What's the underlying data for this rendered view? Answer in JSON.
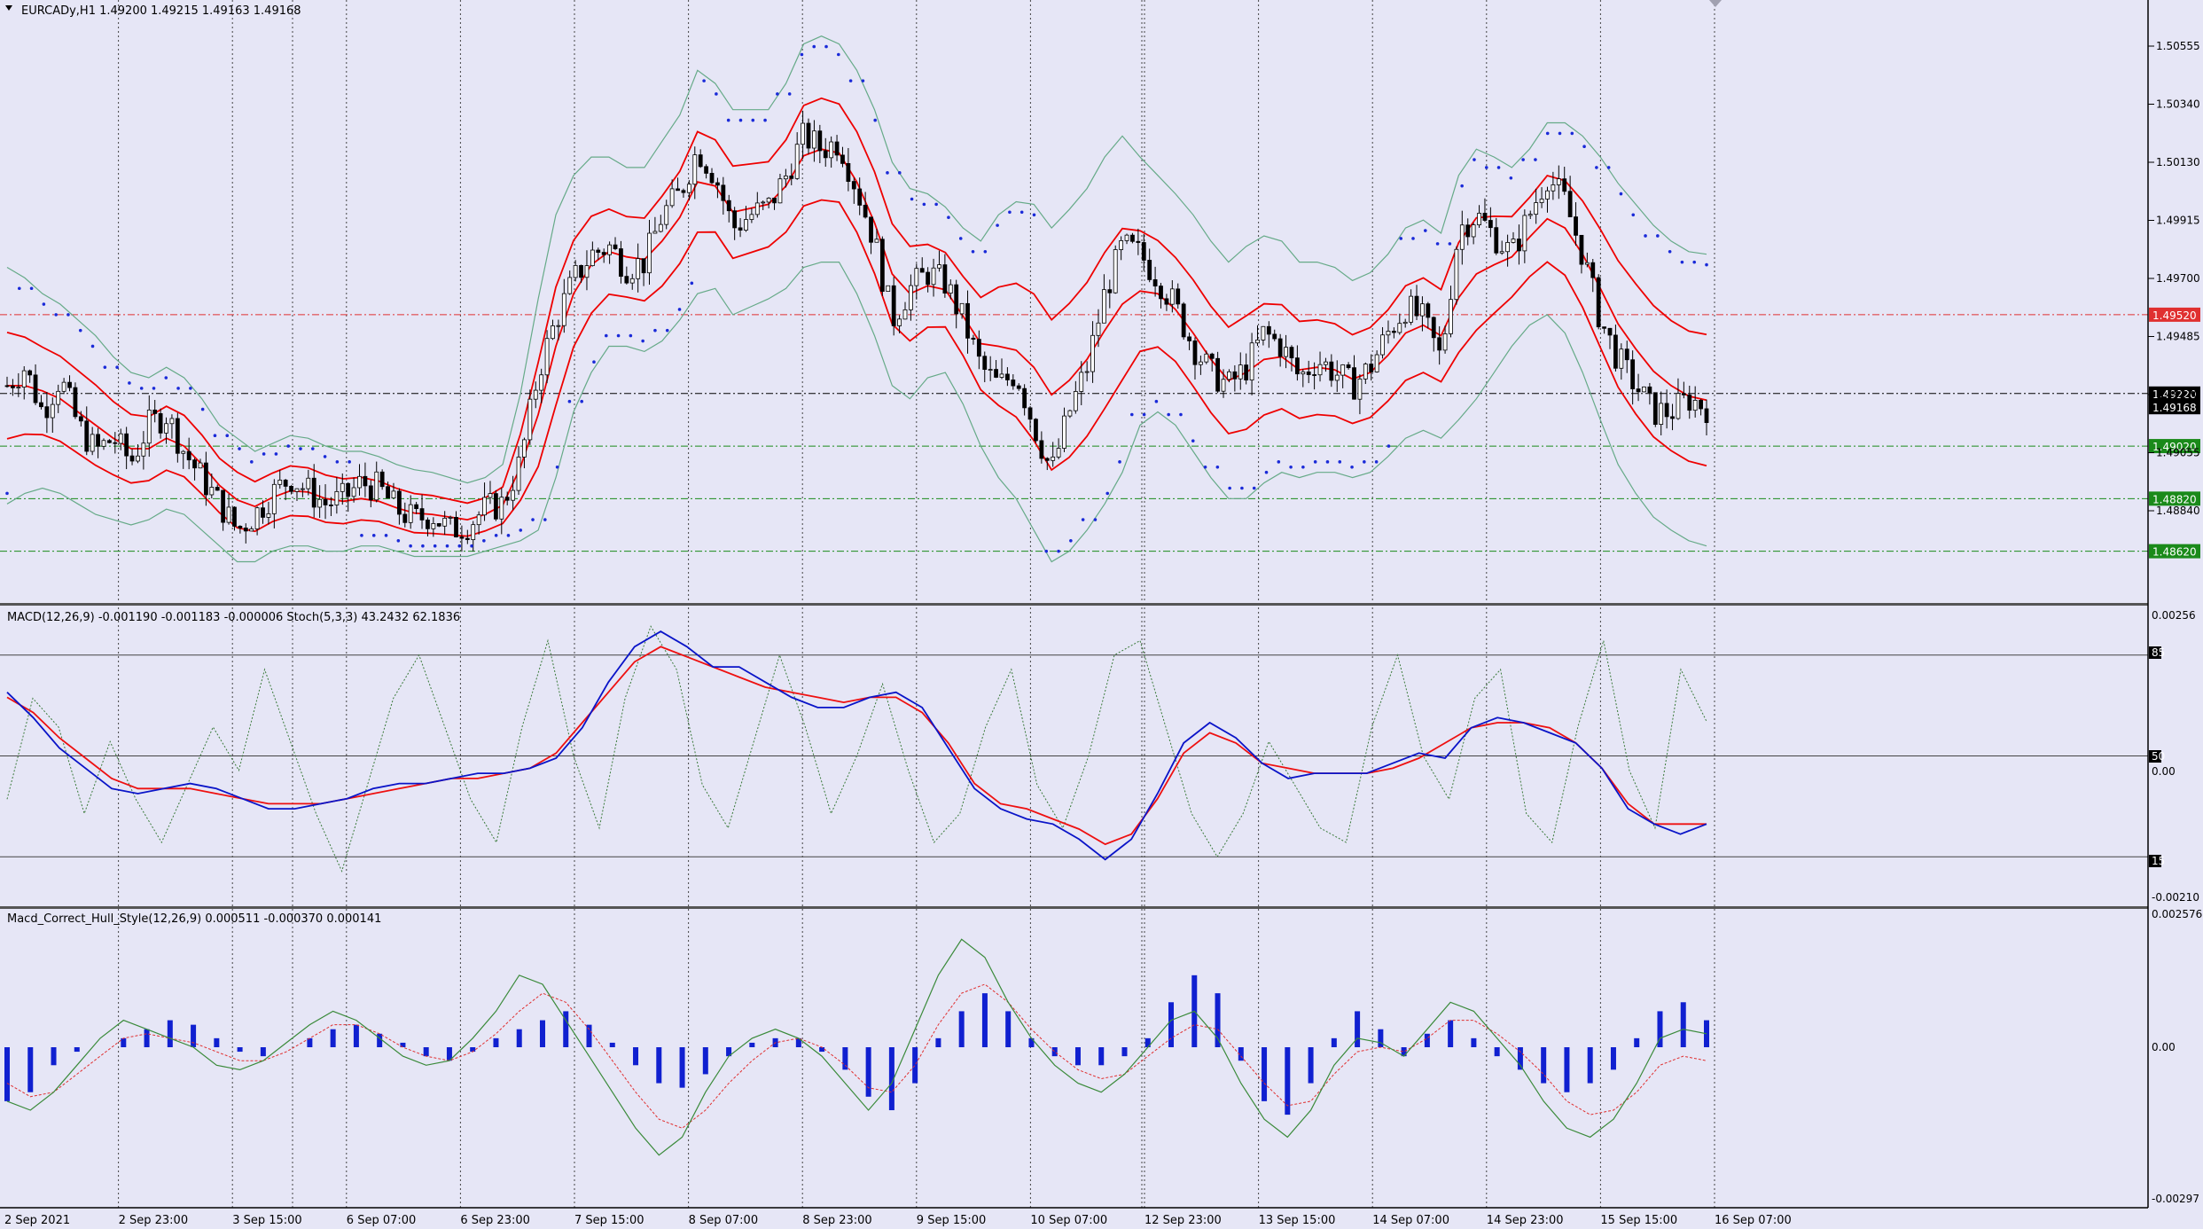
{
  "chart_data": {
    "type": "line",
    "main": {
      "title": "EURCADy,H1  1.49200 1.49215 1.49163 1.49168",
      "ylim": [
        1.4845,
        1.5065
      ],
      "price_ticks": [
        "1.50555",
        "1.50340",
        "1.50130",
        "1.49915",
        "1.49700",
        "1.49485",
        "1.49270",
        "1.49055",
        "1.48840"
      ],
      "levels": [
        {
          "label": "1.49520",
          "value": 1.4952,
          "color": "#e03030"
        },
        {
          "label": "1.49220",
          "value": 1.4922,
          "color": "#000000"
        },
        {
          "label": "1.49168",
          "value": 1.49168,
          "color": "#000000"
        },
        {
          "label": "1.49020",
          "value": 1.4902,
          "color": "#1a8a1a"
        },
        {
          "label": "1.48820",
          "value": 1.4882,
          "color": "#1a8a1a"
        },
        {
          "label": "1.48620",
          "value": 1.4862,
          "color": "#1a8a1a"
        }
      ],
      "close_series": [
        1.4925,
        1.4932,
        1.4915,
        1.4928,
        1.491,
        1.49,
        1.4905,
        1.4896,
        1.491,
        1.4914,
        1.49,
        1.489,
        1.488,
        1.487,
        1.4876,
        1.4884,
        1.489,
        1.4885,
        1.488,
        1.4882,
        1.4888,
        1.4886,
        1.4878,
        1.4874,
        1.4876,
        1.487,
        1.4872,
        1.4878,
        1.488,
        1.4896,
        1.493,
        1.495,
        1.4965,
        1.4975,
        1.4978,
        1.497,
        1.4972,
        1.499,
        1.4998,
        1.5015,
        1.5005,
        1.4985,
        1.499,
        1.4993,
        1.5005,
        1.502,
        1.5015,
        1.5018,
        1.5,
        1.498,
        1.495,
        1.4962,
        1.4968,
        1.4964,
        1.495,
        1.4932,
        1.4925,
        1.493,
        1.491,
        1.4892,
        1.4915,
        1.4932,
        1.496,
        1.4978,
        1.4975,
        1.4966,
        1.4955,
        1.494,
        1.493,
        1.4925,
        1.4932,
        1.4945,
        1.494,
        1.4928,
        1.4935,
        1.493,
        1.4925,
        1.4932,
        1.4945,
        1.4955,
        1.495,
        1.4935,
        1.4985,
        1.499,
        1.4982,
        1.4975,
        1.499,
        1.5005,
        1.4995,
        1.4975,
        1.495,
        1.4935,
        1.4925,
        1.4915,
        1.4915,
        1.492,
        1.49168
      ],
      "upper_band": [
        1.497,
        1.4966,
        1.496,
        1.4956,
        1.495,
        1.4944,
        1.4936,
        1.493,
        1.4928,
        1.4932,
        1.4928,
        1.492,
        1.491,
        1.4905,
        1.49,
        1.4903,
        1.4906,
        1.4905,
        1.4902,
        1.49,
        1.49,
        1.4898,
        1.4895,
        1.4893,
        1.4892,
        1.489,
        1.4888,
        1.489,
        1.4895,
        1.4922,
        1.4958,
        1.499,
        1.5005,
        1.5012,
        1.5012,
        1.5008,
        1.5008,
        1.5018,
        1.5028,
        1.5045,
        1.504,
        1.503,
        1.503,
        1.503,
        1.504,
        1.5055,
        1.5058,
        1.5055,
        1.5045,
        1.503,
        1.501,
        1.5,
        1.4998,
        1.4993,
        1.4985,
        1.498,
        1.499,
        1.4995,
        1.4994,
        1.4985,
        1.4992,
        1.5,
        1.5012,
        1.502,
        1.5012,
        1.5005,
        1.4998,
        1.499,
        1.498,
        1.4972,
        1.4978,
        1.4982,
        1.498,
        1.4972,
        1.4972,
        1.497,
        1.4965,
        1.4968,
        1.4975,
        1.4985,
        1.4988,
        1.4983,
        1.5005,
        1.5015,
        1.5012,
        1.5008,
        1.5015,
        1.5025,
        1.5025,
        1.502,
        1.5012,
        1.5002,
        1.4994,
        1.4986,
        1.498,
        1.4976,
        1.4975
      ],
      "lower_band": [
        1.488,
        1.4884,
        1.4886,
        1.4884,
        1.488,
        1.4876,
        1.4874,
        1.4872,
        1.4874,
        1.4878,
        1.4876,
        1.487,
        1.4864,
        1.4858,
        1.4858,
        1.4862,
        1.4864,
        1.4864,
        1.4862,
        1.4862,
        1.4864,
        1.4864,
        1.4862,
        1.486,
        1.486,
        1.486,
        1.486,
        1.4862,
        1.4864,
        1.4866,
        1.487,
        1.489,
        1.4915,
        1.493,
        1.494,
        1.494,
        1.4938,
        1.4942,
        1.495,
        1.496,
        1.4962,
        1.4952,
        1.4955,
        1.4958,
        1.4962,
        1.497,
        1.4972,
        1.4972,
        1.496,
        1.4944,
        1.4925,
        1.492,
        1.4928,
        1.493,
        1.4918,
        1.4902,
        1.489,
        1.4882,
        1.487,
        1.4858,
        1.4862,
        1.487,
        1.488,
        1.4892,
        1.491,
        1.4915,
        1.491,
        1.49,
        1.489,
        1.4882,
        1.4882,
        1.4888,
        1.4892,
        1.489,
        1.4892,
        1.4892,
        1.489,
        1.4892,
        1.4898,
        1.4905,
        1.4908,
        1.4905,
        1.4912,
        1.492,
        1.493,
        1.494,
        1.4948,
        1.4952,
        1.4945,
        1.493,
        1.4912,
        1.4895,
        1.4884,
        1.4875,
        1.487,
        1.4866,
        1.4864
      ]
    },
    "macd_stoch": {
      "title": "MACD(12,26,9) -0.001190 -0.001183 -0.000006  Stoch(5,3,3) 43.2432 62.1836",
      "ticks": [
        "0.00256",
        "85",
        "50",
        "0.00",
        "15",
        "-0.00210"
      ],
      "macd": [
        0.0013,
        0.0008,
        0.0002,
        -0.0002,
        -0.0006,
        -0.0007,
        -0.0006,
        -0.0005,
        -0.0006,
        -0.0008,
        -0.001,
        -0.001,
        -0.0009,
        -0.0008,
        -0.0006,
        -0.0005,
        -0.0005,
        -0.0004,
        -0.0003,
        -0.0003,
        -0.0002,
        0.0,
        0.0006,
        0.0015,
        0.0022,
        0.0025,
        0.0022,
        0.0018,
        0.0018,
        0.0015,
        0.0012,
        0.001,
        0.001,
        0.0012,
        0.0013,
        0.001,
        0.0002,
        -0.0006,
        -0.001,
        -0.0012,
        -0.0013,
        -0.0016,
        -0.002,
        -0.0016,
        -0.0007,
        0.0003,
        0.0007,
        0.0004,
        -0.0001,
        -0.0004,
        -0.0003,
        -0.0003,
        -0.0003,
        -0.0001,
        0.0001,
        0.0,
        0.0006,
        0.0008,
        0.0007,
        0.0005,
        0.0003,
        -0.0002,
        -0.001,
        -0.0013,
        -0.0015,
        -0.0013
      ],
      "signal": [
        0.0012,
        0.0009,
        0.0004,
        0.0,
        -0.0004,
        -0.0006,
        -0.0006,
        -0.0006,
        -0.0007,
        -0.0008,
        -0.0009,
        -0.0009,
        -0.0009,
        -0.0008,
        -0.0007,
        -0.0006,
        -0.0005,
        -0.0004,
        -0.0004,
        -0.0003,
        -0.0002,
        0.0001,
        0.0007,
        0.0013,
        0.0019,
        0.0022,
        0.002,
        0.0018,
        0.0016,
        0.0014,
        0.0013,
        0.0012,
        0.0011,
        0.0012,
        0.0012,
        0.0009,
        0.0003,
        -0.0005,
        -0.0009,
        -0.001,
        -0.0012,
        -0.0014,
        -0.0017,
        -0.0015,
        -0.0008,
        0.0001,
        0.0005,
        0.0003,
        -0.0001,
        -0.0002,
        -0.0003,
        -0.0003,
        -0.0003,
        -0.0002,
        0.0,
        0.0003,
        0.0006,
        0.0007,
        0.0007,
        0.0006,
        0.0003,
        -0.0002,
        -0.0009,
        -0.0013,
        -0.0013,
        -0.0013
      ],
      "stoch": [
        35,
        70,
        60,
        30,
        55,
        35,
        20,
        40,
        60,
        45,
        80,
        55,
        30,
        10,
        40,
        70,
        85,
        60,
        35,
        20,
        60,
        90,
        50,
        25,
        70,
        95,
        80,
        40,
        25,
        55,
        85,
        60,
        30,
        50,
        75,
        45,
        20,
        30,
        60,
        80,
        40,
        25,
        50,
        85,
        90,
        60,
        30,
        15,
        30,
        55,
        40,
        25,
        20,
        60,
        85,
        50,
        35,
        70,
        80,
        30,
        20,
        60,
        90,
        45,
        25,
        80,
        62
      ]
    },
    "hull": {
      "title": "Macd_Correct_Hull_Style(12,26,9) 0.000511 -0.000370 0.000141",
      "ticks": [
        "0.002576",
        "0.00",
        "-0.00297"
      ],
      "hist": [
        -0.0012,
        -0.001,
        -0.0004,
        -0.0001,
        0.0,
        0.0002,
        0.0004,
        0.0006,
        0.0005,
        0.0002,
        -0.0001,
        -0.0002,
        0.0,
        0.0002,
        0.0004,
        0.0005,
        0.0003,
        0.0001,
        -0.0002,
        -0.0003,
        -0.0001,
        0.0002,
        0.0004,
        0.0006,
        0.0008,
        0.0005,
        0.0001,
        -0.0004,
        -0.0008,
        -0.0009,
        -0.0006,
        -0.0002,
        0.0001,
        0.0002,
        0.0002,
        -0.0001,
        -0.0005,
        -0.0011,
        -0.0014,
        -0.0008,
        0.0002,
        0.0008,
        0.0012,
        0.0008,
        0.0002,
        -0.0002,
        -0.0004,
        -0.0004,
        -0.0002,
        0.0002,
        0.001,
        0.0016,
        0.0012,
        -0.0003,
        -0.0012,
        -0.0015,
        -0.0008,
        0.0002,
        0.0008,
        0.0004,
        -0.0002,
        0.0003,
        0.0006,
        0.0002,
        -0.0002,
        -0.0005,
        -0.0008,
        -0.001,
        -0.0008,
        -0.0005,
        0.0002,
        0.0008,
        0.001,
        0.0006
      ],
      "line": [
        -0.0012,
        -0.0014,
        -0.001,
        -0.0004,
        0.0002,
        0.0006,
        0.0004,
        0.0002,
        0.0,
        -0.0004,
        -0.0005,
        -0.0003,
        0.0001,
        0.0005,
        0.0008,
        0.0006,
        0.0002,
        -0.0002,
        -0.0004,
        -0.0003,
        0.0002,
        0.0008,
        0.0016,
        0.0014,
        0.0006,
        -0.0002,
        -0.001,
        -0.0018,
        -0.0024,
        -0.002,
        -0.001,
        -0.0002,
        0.0002,
        0.0004,
        0.0002,
        -0.0002,
        -0.0008,
        -0.0014,
        -0.0008,
        0.0004,
        0.0016,
        0.0024,
        0.002,
        0.001,
        0.0002,
        -0.0004,
        -0.0008,
        -0.001,
        -0.0006,
        0.0,
        0.0006,
        0.0008,
        0.0002,
        -0.0008,
        -0.0016,
        -0.002,
        -0.0014,
        -0.0004,
        0.0002,
        0.0001,
        -0.0002,
        0.0004,
        0.001,
        0.0008,
        0.0002,
        -0.0004,
        -0.0012,
        -0.0018,
        -0.002,
        -0.0016,
        -0.0008,
        0.0002,
        0.0004,
        0.0003
      ],
      "signal": [
        -0.0008,
        -0.0011,
        -0.001,
        -0.0006,
        -0.0002,
        0.0002,
        0.0003,
        0.0002,
        0.0001,
        -0.0001,
        -0.0003,
        -0.0003,
        -0.0001,
        0.0002,
        0.0005,
        0.0005,
        0.0003,
        0.0,
        -0.0002,
        -0.0003,
        -0.0001,
        0.0003,
        0.0008,
        0.0012,
        0.001,
        0.0004,
        -0.0003,
        -0.001,
        -0.0016,
        -0.0018,
        -0.0014,
        -0.0008,
        -0.0003,
        0.0001,
        0.0002,
        0.0,
        -0.0004,
        -0.0009,
        -0.001,
        -0.0004,
        0.0005,
        0.0012,
        0.0014,
        0.001,
        0.0004,
        -0.0001,
        -0.0005,
        -0.0007,
        -0.0006,
        -0.0002,
        0.0002,
        0.0005,
        0.0004,
        -0.0002,
        -0.0008,
        -0.0013,
        -0.0012,
        -0.0006,
        -0.0001,
        0.0,
        -0.0001,
        0.0002,
        0.0006,
        0.0006,
        0.0003,
        -0.0001,
        -0.0006,
        -0.0012,
        -0.0015,
        -0.0014,
        -0.001,
        -0.0004,
        -0.0002,
        -0.0003
      ]
    },
    "time_labels": [
      "2 Sep 2021",
      "2 Sep 23:00",
      "3 Sep 15:00",
      "6 Sep 07:00",
      "6 Sep 23:00",
      "7 Sep 15:00",
      "8 Sep 07:00",
      "8 Sep 23:00",
      "9 Sep 15:00",
      "10 Sep 07:00",
      "12 Sep 23:00",
      "13 Sep 15:00",
      "14 Sep 07:00",
      "14 Sep 23:00",
      "15 Sep 15:00",
      "16 Sep 07:00"
    ]
  },
  "colors": {
    "background": "#e6e6f6",
    "candle_up": "#ffffff",
    "candle_down": "#000000",
    "band_outer": "#66aa88",
    "band_inner": "#ee0000",
    "sar": "#1a2ad8",
    "macd": "#0a14c8",
    "signal": "#ee1010",
    "stoch": "#3a7a3a",
    "hist": "#1020d0",
    "hull_line": "#3a8a3a",
    "hull_signal": "#e03030"
  }
}
